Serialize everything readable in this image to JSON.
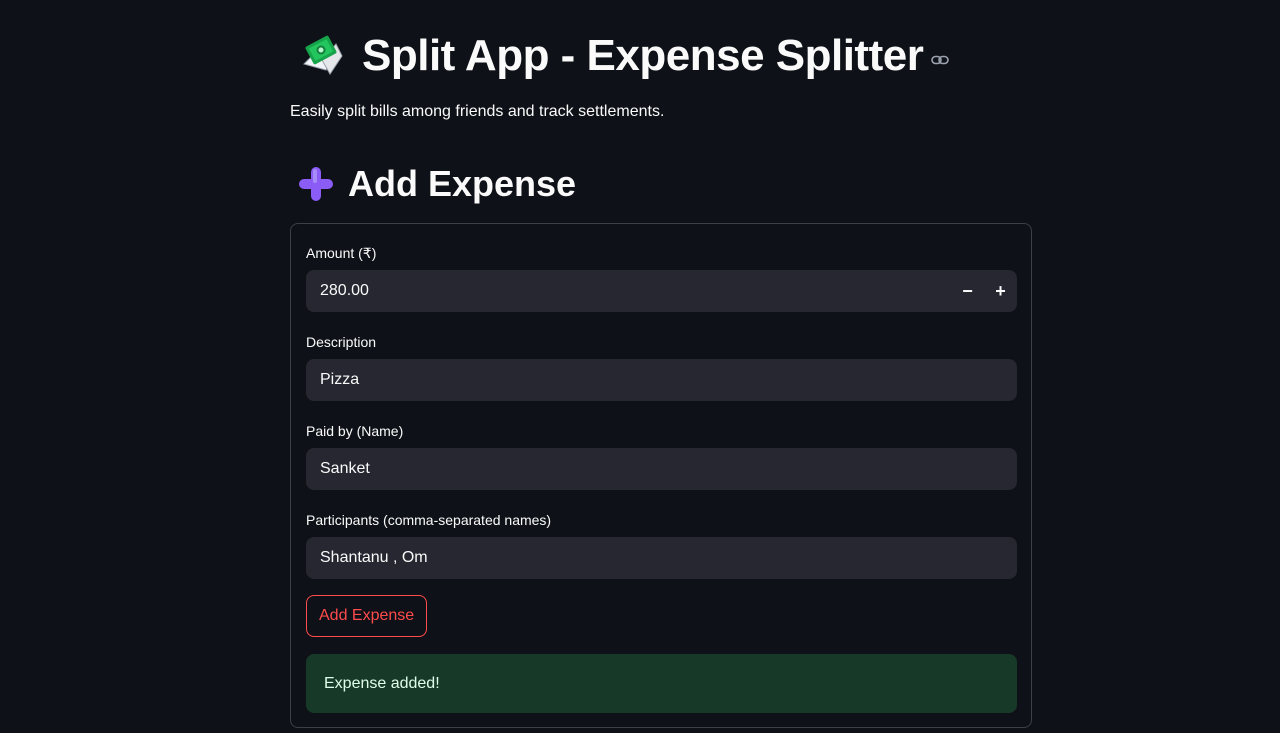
{
  "header": {
    "title": "Split App - Expense Splitter",
    "title_icon": "money-with-wings-icon",
    "anchor_icon": "link-icon",
    "subtitle": "Easily split bills among friends and track settlements."
  },
  "section": {
    "title": "Add Expense",
    "icon": "plus-icon"
  },
  "form": {
    "amount": {
      "label": "Amount (₹)",
      "value": "280.00",
      "decrement": "−",
      "increment": "+"
    },
    "description": {
      "label": "Description",
      "value": "Pizza"
    },
    "paid_by": {
      "label": "Paid by (Name)",
      "value": "Sanket"
    },
    "participants": {
      "label": "Participants (comma-separated names)",
      "value": "Shantanu , Om"
    },
    "submit_label": "Add Expense",
    "success_message": "Expense added!"
  },
  "colors": {
    "background": "#0e1117",
    "input_background": "#262730",
    "primary": "#ff4b4b",
    "success_background": "#173928",
    "success_text": "#dffde9",
    "plus_icon": "#8b5cf6"
  }
}
